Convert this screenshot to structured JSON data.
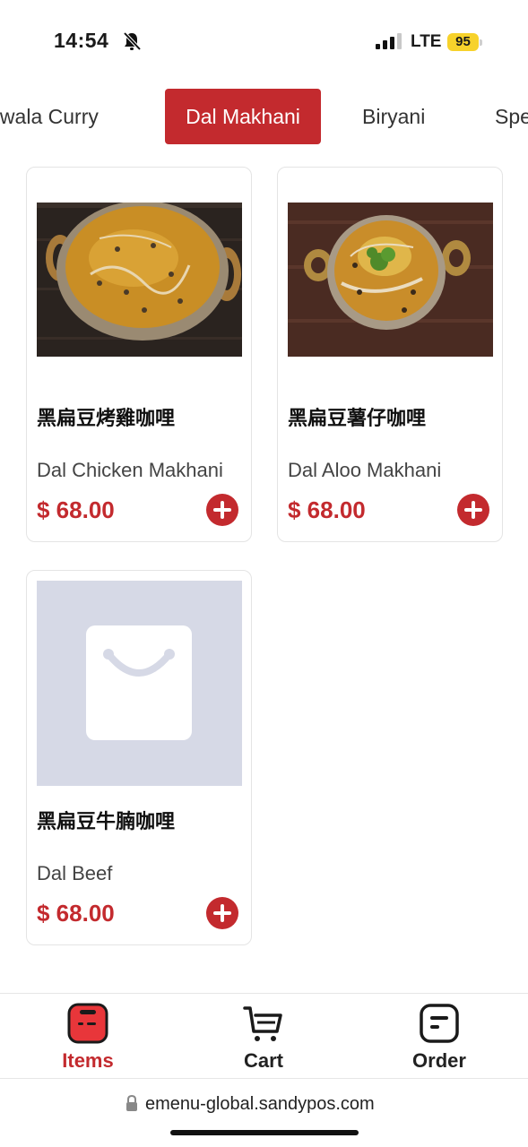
{
  "status_bar": {
    "time": "14:54",
    "network": "LTE",
    "battery": "95"
  },
  "categories": [
    {
      "label": "Bhindiwala Curry"
    },
    {
      "label": "Dal Makhani"
    },
    {
      "label": "Biryani"
    },
    {
      "label": "Special"
    }
  ],
  "products": [
    {
      "name_zh": "黑扁豆烤雞咖哩",
      "name_en": "Dal Chicken Makhani",
      "price": "$ 68.00"
    },
    {
      "name_zh": "黑扁豆薯仔咖哩",
      "name_en": "Dal Aloo Makhani",
      "price": "$ 68.00"
    },
    {
      "name_zh": "黑扁豆牛腩咖哩",
      "name_en": "Dal Beef",
      "price": "$ 68.00"
    }
  ],
  "nav": {
    "items_label": "Items",
    "cart_label": "Cart",
    "order_label": "Order"
  },
  "url": "emenu-global.sandypos.com",
  "colors": {
    "accent": "#c32a2e",
    "battery": "#f7d22b",
    "placeholder": "#d6d9e6"
  }
}
